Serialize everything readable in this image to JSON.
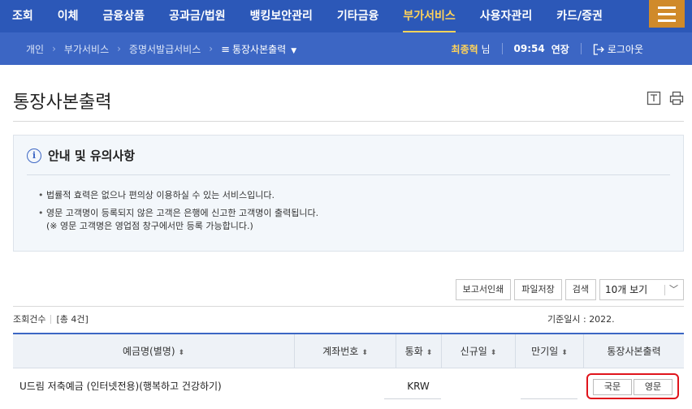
{
  "topnav": {
    "items": [
      {
        "label": "조회"
      },
      {
        "label": "이체"
      },
      {
        "label": "금융상품"
      },
      {
        "label": "공과금/법원"
      },
      {
        "label": "뱅킹보안관리"
      },
      {
        "label": "기타금융"
      },
      {
        "label": "부가서비스",
        "active": true
      },
      {
        "label": "사용자관리"
      },
      {
        "label": "카드/증권"
      }
    ],
    "menu_icon": "hamburger-icon"
  },
  "breadcrumb": {
    "items": [
      "개인",
      "부가서비스",
      "증명서발급서비스",
      "통장사본출력"
    ],
    "current_icon": "list-icon"
  },
  "session": {
    "user_name": "최종혁",
    "honorific": "님",
    "time_left": "09:54",
    "extend_label": "연장",
    "logout_label": "로그아웃"
  },
  "page": {
    "title": "통장사본출력",
    "tools": [
      "download-icon",
      "print-icon"
    ]
  },
  "notice": {
    "title": "안내 및 유의사항",
    "items": [
      "법률적 효력은 없으나 편의상 이용하실 수 있는 서비스입니다.",
      "영문 고객명이 등록되지 않은 고객은 은행에 신고한 고객명이 출력됩니다."
    ],
    "sub_note": "(※ 영문 고객명은 영업점 창구에서만 등록 가능합니다.)"
  },
  "actions": {
    "report_print": "보고서인쇄",
    "save_file": "파일저장",
    "search": "검색",
    "page_size": "10개 보기"
  },
  "summary": {
    "count_label": "조회건수",
    "count_value": "[총 4건]",
    "base_date_label": "기준일시 :",
    "base_date_value": "2022."
  },
  "table": {
    "headers": [
      "예금명(별명)",
      "계좌번호",
      "통화",
      "신규일",
      "만기일",
      "통장사본출력"
    ],
    "sort_glyph": "⬍",
    "rows": [
      {
        "name": "U드림 저축예금 (인터넷전용)(행복하고 건강하기)",
        "account": "",
        "currency": "KRW",
        "opened": "",
        "maturity": "",
        "btn_korean": "국문",
        "btn_english": "영문"
      }
    ]
  },
  "colors": {
    "nav_bg": "#2c58b8",
    "crumb_bg": "#3c66c4",
    "active": "#ffd35a",
    "menu_button": "#d08a2a",
    "highlight": "#e0141c"
  }
}
